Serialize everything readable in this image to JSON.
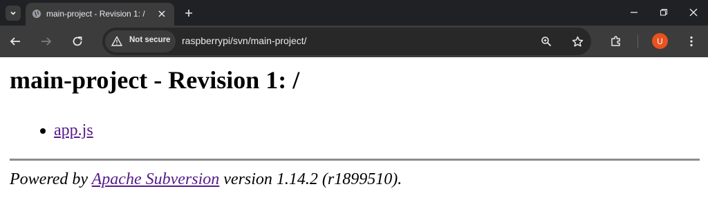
{
  "browser": {
    "tab": {
      "title": "main-project - Revision 1: /"
    },
    "omnibox": {
      "security_label": "Not secure",
      "url": "raspberrypi/svn/main-project/"
    },
    "profile_initial": "U"
  },
  "page": {
    "heading": "main-project - Revision 1: /",
    "entries": [
      {
        "name": "app.js"
      }
    ],
    "footer": {
      "prefix": "Powered by ",
      "link_text": "Apache Subversion",
      "suffix": " version 1.14.2 (r1899510)."
    }
  },
  "colors": {
    "link_visited": "#551a8b",
    "avatar": "#e8521e"
  }
}
